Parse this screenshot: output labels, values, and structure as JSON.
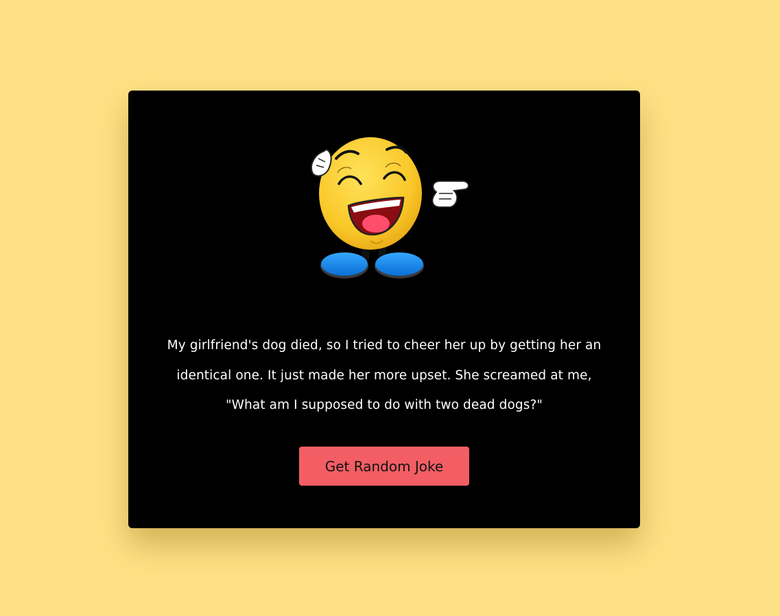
{
  "joke": {
    "text": "My girlfriend's dog died, so I tried to cheer her up by getting her an identical one. It just made her more upset. She screamed at me, \"What am I supposed to do with two dead dogs?\""
  },
  "button": {
    "label": "Get Random Joke"
  },
  "illustration": {
    "icon": "laughing-emoji-icon"
  },
  "colors": {
    "page_background": "#ffe185",
    "card_background": "#000000",
    "button_background": "#f25e64",
    "joke_text": "#ffffff"
  }
}
